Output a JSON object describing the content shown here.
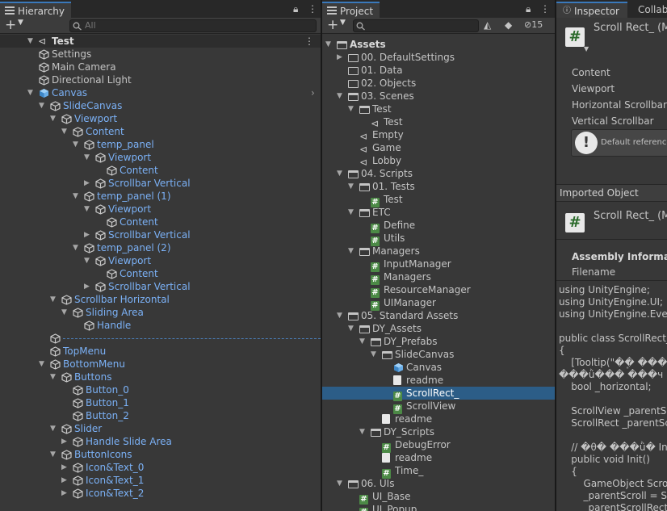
{
  "hierarchy": {
    "tab_label": "Hierarchy",
    "search_placeholder": "All",
    "scene": "Test",
    "items": [
      {
        "label": "Settings",
        "depth": 0,
        "blue": false,
        "arrow": "",
        "icon": "gameobject-icon"
      },
      {
        "label": "Main Camera",
        "depth": 0,
        "blue": false,
        "arrow": "",
        "icon": "gameobject-icon"
      },
      {
        "label": "Directional Light",
        "depth": 0,
        "blue": false,
        "arrow": "",
        "icon": "gameobject-icon"
      },
      {
        "label": "Canvas",
        "depth": 0,
        "blue": true,
        "arrow": "▼",
        "icon": "prefab-icon"
      },
      {
        "label": "SlideCanvas",
        "depth": 1,
        "blue": true,
        "arrow": "▼",
        "icon": "gameobject-icon"
      },
      {
        "label": "Viewport",
        "depth": 2,
        "blue": true,
        "arrow": "▼",
        "icon": "gameobject-icon"
      },
      {
        "label": "Content",
        "depth": 3,
        "blue": true,
        "arrow": "▼",
        "icon": "gameobject-icon"
      },
      {
        "label": "temp_panel",
        "depth": 4,
        "blue": true,
        "arrow": "▼",
        "icon": "gameobject-icon"
      },
      {
        "label": "Viewport",
        "depth": 5,
        "blue": true,
        "arrow": "▼",
        "icon": "gameobject-icon"
      },
      {
        "label": "Content",
        "depth": 6,
        "blue": true,
        "arrow": "",
        "icon": "gameobject-icon"
      },
      {
        "label": "Scrollbar Vertical",
        "depth": 5,
        "blue": true,
        "arrow": "▶",
        "icon": "gameobject-icon"
      },
      {
        "label": "temp_panel (1)",
        "depth": 4,
        "blue": true,
        "arrow": "▼",
        "icon": "gameobject-icon"
      },
      {
        "label": "Viewport",
        "depth": 5,
        "blue": true,
        "arrow": "▼",
        "icon": "gameobject-icon"
      },
      {
        "label": "Content",
        "depth": 6,
        "blue": true,
        "arrow": "",
        "icon": "gameobject-icon"
      },
      {
        "label": "Scrollbar Vertical",
        "depth": 5,
        "blue": true,
        "arrow": "▶",
        "icon": "gameobject-icon"
      },
      {
        "label": "temp_panel (2)",
        "depth": 4,
        "blue": true,
        "arrow": "▼",
        "icon": "gameobject-icon"
      },
      {
        "label": "Viewport",
        "depth": 5,
        "blue": true,
        "arrow": "▼",
        "icon": "gameobject-icon"
      },
      {
        "label": "Content",
        "depth": 6,
        "blue": true,
        "arrow": "",
        "icon": "gameobject-icon"
      },
      {
        "label": "Scrollbar Vertical",
        "depth": 5,
        "blue": true,
        "arrow": "▶",
        "icon": "gameobject-icon"
      },
      {
        "label": "Scrollbar Horizontal",
        "depth": 2,
        "blue": true,
        "arrow": "▼",
        "icon": "gameobject-icon"
      },
      {
        "label": "Sliding Area",
        "depth": 3,
        "blue": true,
        "arrow": "▼",
        "icon": "gameobject-icon"
      },
      {
        "label": "Handle",
        "depth": 4,
        "blue": true,
        "arrow": "",
        "icon": "gameobject-icon"
      },
      {
        "label": "",
        "depth": 1,
        "blue": true,
        "arrow": "",
        "icon": "gameobject-icon",
        "dashed": true
      },
      {
        "label": "TopMenu",
        "depth": 1,
        "blue": true,
        "arrow": "",
        "icon": "gameobject-icon"
      },
      {
        "label": "BottomMenu",
        "depth": 1,
        "blue": true,
        "arrow": "▼",
        "icon": "gameobject-icon"
      },
      {
        "label": "Buttons",
        "depth": 2,
        "blue": true,
        "arrow": "▼",
        "icon": "gameobject-icon"
      },
      {
        "label": "Button_0",
        "depth": 3,
        "blue": true,
        "arrow": "",
        "icon": "gameobject-icon"
      },
      {
        "label": "Button_1",
        "depth": 3,
        "blue": true,
        "arrow": "",
        "icon": "gameobject-icon"
      },
      {
        "label": "Button_2",
        "depth": 3,
        "blue": true,
        "arrow": "",
        "icon": "gameobject-icon"
      },
      {
        "label": "Slider",
        "depth": 2,
        "blue": true,
        "arrow": "▼",
        "icon": "gameobject-icon"
      },
      {
        "label": "Handle Slide Area",
        "depth": 3,
        "blue": true,
        "arrow": "▶",
        "icon": "gameobject-icon"
      },
      {
        "label": "ButtonIcons",
        "depth": 2,
        "blue": true,
        "arrow": "▼",
        "icon": "gameobject-icon"
      },
      {
        "label": "Icon&Text_0",
        "depth": 3,
        "blue": true,
        "arrow": "▶",
        "icon": "gameobject-icon"
      },
      {
        "label": "Icon&Text_1",
        "depth": 3,
        "blue": true,
        "arrow": "▶",
        "icon": "gameobject-icon"
      },
      {
        "label": "Icon&Text_2",
        "depth": 3,
        "blue": true,
        "arrow": "▶",
        "icon": "gameobject-icon"
      }
    ]
  },
  "project": {
    "tab_label": "Project",
    "hidden_count": "15",
    "items": [
      {
        "label": "Assets",
        "depth": 0,
        "arrow": "▼",
        "icon": "folder-open",
        "bold": true
      },
      {
        "label": "00. DefaultSettings",
        "depth": 1,
        "arrow": "▶",
        "icon": "folder"
      },
      {
        "label": "01. Data",
        "depth": 1,
        "arrow": "",
        "icon": "folder"
      },
      {
        "label": "02. Objects",
        "depth": 1,
        "arrow": "",
        "icon": "folder"
      },
      {
        "label": "03. Scenes",
        "depth": 1,
        "arrow": "▼",
        "icon": "folder-open"
      },
      {
        "label": "Test",
        "depth": 2,
        "arrow": "▼",
        "icon": "folder-open"
      },
      {
        "label": "Test",
        "depth": 3,
        "arrow": "",
        "icon": "unity"
      },
      {
        "label": "Empty",
        "depth": 2,
        "arrow": "",
        "icon": "unity"
      },
      {
        "label": "Game",
        "depth": 2,
        "arrow": "",
        "icon": "unity"
      },
      {
        "label": "Lobby",
        "depth": 2,
        "arrow": "",
        "icon": "unity"
      },
      {
        "label": "04. Scripts",
        "depth": 1,
        "arrow": "▼",
        "icon": "folder-open"
      },
      {
        "label": "01. Tests",
        "depth": 2,
        "arrow": "▼",
        "icon": "folder-open"
      },
      {
        "label": "Test",
        "depth": 3,
        "arrow": "",
        "icon": "script"
      },
      {
        "label": "ETC",
        "depth": 2,
        "arrow": "▼",
        "icon": "folder-open"
      },
      {
        "label": "Define",
        "depth": 3,
        "arrow": "",
        "icon": "script"
      },
      {
        "label": "Utils",
        "depth": 3,
        "arrow": "",
        "icon": "script"
      },
      {
        "label": "Managers",
        "depth": 2,
        "arrow": "▼",
        "icon": "folder-open"
      },
      {
        "label": "InputManager",
        "depth": 3,
        "arrow": "",
        "icon": "script"
      },
      {
        "label": "Managers",
        "depth": 3,
        "arrow": "",
        "icon": "script"
      },
      {
        "label": "ResourceManager",
        "depth": 3,
        "arrow": "",
        "icon": "script"
      },
      {
        "label": "UIManager",
        "depth": 3,
        "arrow": "",
        "icon": "script"
      },
      {
        "label": "05. Standard Assets",
        "depth": 1,
        "arrow": "▼",
        "icon": "folder-open"
      },
      {
        "label": "DY_Assets",
        "depth": 2,
        "arrow": "▼",
        "icon": "folder-open"
      },
      {
        "label": "DY_Prefabs",
        "depth": 3,
        "arrow": "▼",
        "icon": "folder-open"
      },
      {
        "label": "SlideCanvas",
        "depth": 4,
        "arrow": "▼",
        "icon": "folder-open"
      },
      {
        "label": "Canvas",
        "depth": 5,
        "arrow": "",
        "icon": "prefab"
      },
      {
        "label": "readme",
        "depth": 5,
        "arrow": "",
        "icon": "doc"
      },
      {
        "label": "ScrollRect_",
        "depth": 5,
        "arrow": "",
        "icon": "script",
        "selected": true
      },
      {
        "label": "ScrollView",
        "depth": 5,
        "arrow": "",
        "icon": "script"
      },
      {
        "label": "readme",
        "depth": 4,
        "arrow": "",
        "icon": "doc"
      },
      {
        "label": "DY_Scripts",
        "depth": 3,
        "arrow": "▼",
        "icon": "folder-open"
      },
      {
        "label": "DebugError",
        "depth": 4,
        "arrow": "",
        "icon": "script"
      },
      {
        "label": "readme",
        "depth": 4,
        "arrow": "",
        "icon": "doc"
      },
      {
        "label": "Time_",
        "depth": 4,
        "arrow": "",
        "icon": "script"
      },
      {
        "label": "06. UIs",
        "depth": 1,
        "arrow": "▼",
        "icon": "folder-open"
      },
      {
        "label": "UI_Base",
        "depth": 2,
        "arrow": "",
        "icon": "script"
      },
      {
        "label": "UI_Popup",
        "depth": 2,
        "arrow": "",
        "icon": "script"
      }
    ]
  },
  "inspector": {
    "tab_label": "Inspector",
    "tab2_label": "Collab",
    "title": "Scroll Rect_ (M",
    "fields": [
      "Content",
      "Viewport",
      "Horizontal Scrollbar",
      "Vertical Scrollbar"
    ],
    "info_text": "Default reference",
    "imported_object": "Imported Object",
    "imported_title": "Scroll Rect_ (M",
    "assembly_header": "Assembly Informatio",
    "filename_label": "Filename",
    "code": "using UnityEngine;\nusing UnityEngine.UI;\nusing UnityEngine.Event\n\npublic class ScrollRect_\n{\n    [Tooltip(\"�ܸ� ���ǵ�\n���ǜ��� ���ч\n    bool _horizontal;\n\n    ScrollView _parentScr\n    ScrollRect _parentScr\n\n    // �θ� ���ǜ� Init\n    public void Init()\n    {\n        GameObject Scroll_\n        _parentScroll = Scro\n        _parentScrollRect ="
  }
}
